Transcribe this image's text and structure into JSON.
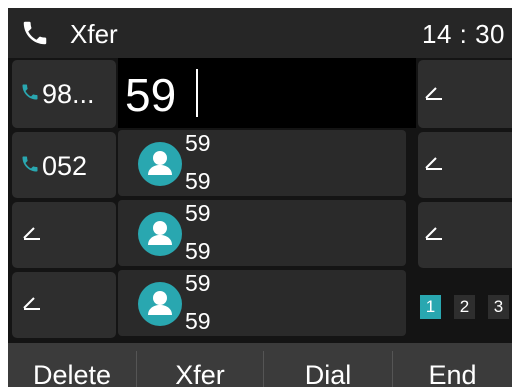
{
  "status_bar": {
    "title": "Xfer",
    "time": "14 : 30"
  },
  "dial": {
    "input_value": "59"
  },
  "line_keys": [
    {
      "label": "98...",
      "icon": "phone-icon",
      "color": "#29a7b0"
    },
    {
      "label": "052",
      "icon": "phone-icon",
      "color": "#29a7b0"
    },
    {
      "label": "",
      "icon": "edit-icon"
    },
    {
      "label": "",
      "icon": "edit-icon"
    }
  ],
  "contacts": [
    {
      "name": "59",
      "number": "59"
    },
    {
      "name": "59",
      "number": "59"
    },
    {
      "name": "59",
      "number": "59"
    }
  ],
  "pagination": {
    "pages": [
      "1",
      "2",
      "3"
    ],
    "active": "1"
  },
  "softkeys": [
    "Delete",
    "Xfer",
    "Dial",
    "End"
  ],
  "colors": {
    "accent": "#29a7b0",
    "background": "#141414"
  }
}
